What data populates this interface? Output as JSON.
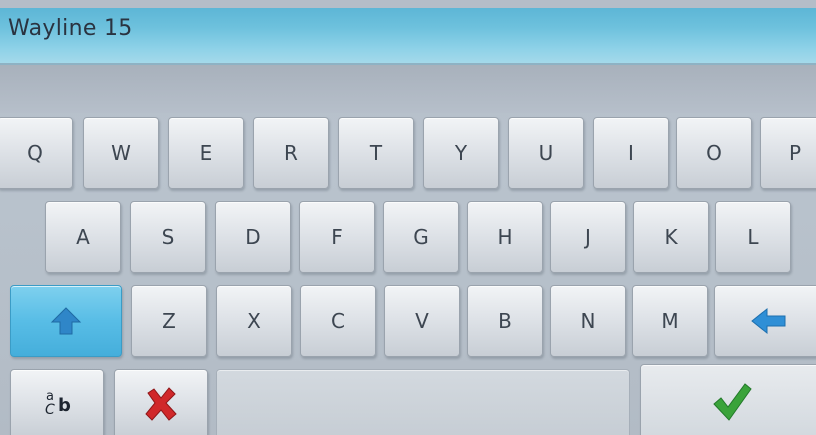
{
  "window": {
    "title": "Wayline 15"
  },
  "keyboard": {
    "rows": [
      [
        "Q",
        "W",
        "E",
        "R",
        "T",
        "Y",
        "U",
        "I",
        "O",
        "P"
      ],
      [
        "A",
        "S",
        "D",
        "F",
        "G",
        "H",
        "J",
        "K",
        "L"
      ],
      [
        "Z",
        "X",
        "C",
        "V",
        "B",
        "N",
        "M"
      ]
    ],
    "shift": {
      "icon": "up-arrow-icon",
      "active": true,
      "color": "#58bde6"
    },
    "backspace": {
      "icon": "left-arrow-icon",
      "color": "#2f8fd6"
    },
    "case_toggle": {
      "icon": "case-toggle-icon",
      "glyph_a": "a",
      "glyph_c": "C",
      "glyph_b": "b"
    },
    "cancel": {
      "icon": "red-x-icon",
      "color": "#d0282a"
    },
    "confirm": {
      "icon": "green-checkmark-icon",
      "color": "#3aa33a"
    }
  }
}
